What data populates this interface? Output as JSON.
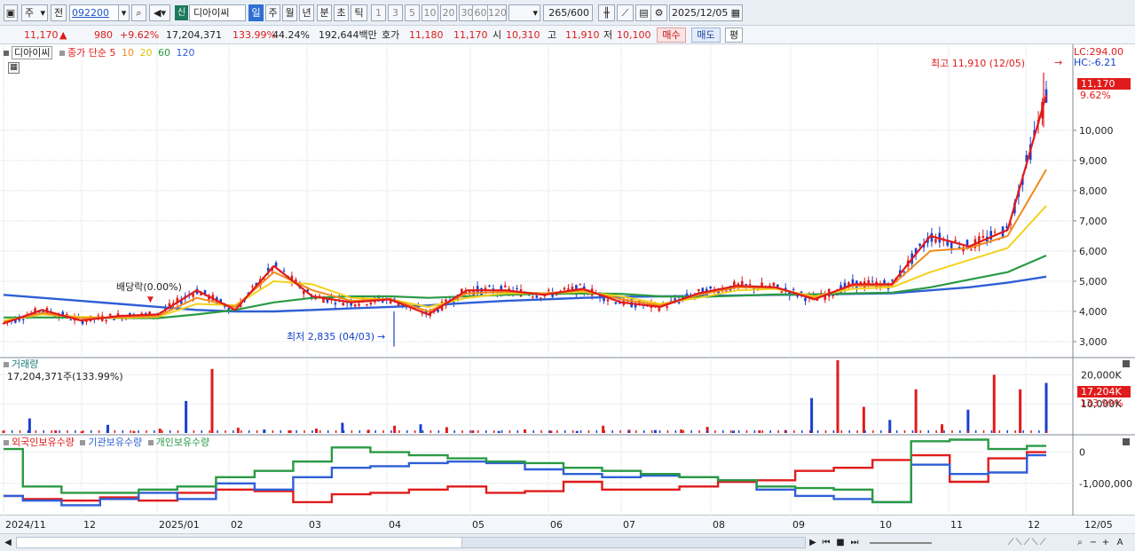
{
  "toolbar": {
    "period_select": "주",
    "prev_label": "전",
    "stock_code": "092200",
    "badge": "신",
    "stock_name": "디아이씨",
    "period_tabs": [
      "일",
      "주",
      "월",
      "년",
      "분",
      "초",
      "틱"
    ],
    "active_tab": "일",
    "minute_options": [
      "1",
      "3",
      "5",
      "10",
      "20",
      "30",
      "60",
      "120"
    ],
    "count": "265",
    "count_max": "/600",
    "date": "2025/12/05"
  },
  "quote": {
    "price": "11,170",
    "change_arrow": "▲",
    "change": "980",
    "change_pct": "+9.62%",
    "volume": "17,204,371",
    "volume_ratio": "133.99%",
    "turnover": "44.24%",
    "amount": "192,644백만",
    "ask_label": "호가",
    "ask1": "11,180",
    "ask2": "11,170",
    "open_label": "시",
    "open": "10,310",
    "high_label": "고",
    "high": "11,910",
    "low_label": "저",
    "low": "10,100",
    "buy_label": "매수",
    "sell_label": "매도",
    "eval_label": "평"
  },
  "price_panel": {
    "stock_label": "디아이씨",
    "ma_prefix": "종가 단순",
    "ma_periods": [
      "5",
      "10",
      "20",
      "60",
      "120"
    ],
    "ma_colors": [
      "#e01b1b",
      "#f08a1c",
      "#f2d21c",
      "#2a9a44",
      "#2f5fd6"
    ],
    "lc_label": "LC:294.00",
    "hc_label": "HC:-6.21",
    "last_price_label": "11,170",
    "last_pct_label": "9.62%",
    "high_annotation": "최고 11,910 (12/05)",
    "low_annotation": "최저 2,835 (04/03)",
    "dividend_annotation": "배당락(0.00%)"
  },
  "volume_panel": {
    "title": "거래량",
    "value_label": "17,204,371주(133.99%)",
    "last_label": "17,204K",
    "last_pct": "133.99%"
  },
  "holdings_panel": {
    "series_labels": [
      "외국인보유수량",
      "기관보유수량",
      "개인보유수량"
    ],
    "series_colors": [
      "#e01b1b",
      "#2f5fd6",
      "#2a9a44"
    ]
  },
  "chart_data": [
    {
      "type": "line",
      "title": "",
      "chart": "price",
      "x": [
        "2024/11",
        "12",
        "2025/01",
        "02",
        "03",
        "04",
        "05",
        "06",
        "07",
        "08",
        "09",
        "10",
        "11",
        "12",
        "12/05"
      ],
      "ylim": [
        2500,
        12200
      ],
      "yticks": [
        "3,000",
        "4,000",
        "5,000",
        "6,000",
        "7,000",
        "8,000",
        "9,000",
        "10,000"
      ],
      "series": [
        {
          "name": "5",
          "values": [
            3600,
            4050,
            3700,
            3850,
            3900,
            4700,
            4050,
            5500,
            4500,
            4300,
            4400,
            3900,
            4700,
            4700,
            4550,
            4750,
            4300,
            4150,
            4600,
            4850,
            4800,
            4400,
            4900,
            4900,
            6500,
            6150,
            6700,
            11170
          ]
        },
        {
          "name": "10",
          "values": [
            3650,
            3950,
            3780,
            3800,
            3850,
            4450,
            4150,
            5300,
            4700,
            4350,
            4420,
            4000,
            4600,
            4650,
            4600,
            4700,
            4400,
            4200,
            4550,
            4800,
            4780,
            4450,
            4850,
            4860,
            6000,
            6100,
            6500,
            8700
          ]
        },
        {
          "name": "20",
          "values": [
            3700,
            3900,
            3820,
            3780,
            3820,
            4250,
            4200,
            5000,
            4900,
            4450,
            4400,
            4150,
            4450,
            4600,
            4600,
            4650,
            4500,
            4250,
            4450,
            4700,
            4750,
            4500,
            4750,
            4800,
            5300,
            5700,
            6100,
            7500
          ]
        },
        {
          "name": "60",
          "values": [
            3800,
            3800,
            3800,
            3780,
            3780,
            3900,
            4050,
            4300,
            4450,
            4500,
            4500,
            4450,
            4500,
            4550,
            4580,
            4600,
            4580,
            4500,
            4480,
            4520,
            4560,
            4560,
            4600,
            4620,
            4800,
            5050,
            5300,
            5850
          ]
        },
        {
          "name": "120",
          "values": [
            4550,
            4450,
            4350,
            4250,
            4150,
            4050,
            4000,
            4000,
            4050,
            4100,
            4150,
            4200,
            4280,
            4350,
            4400,
            4450,
            4480,
            4500,
            4510,
            4530,
            4550,
            4560,
            4580,
            4600,
            4700,
            4800,
            4950,
            5150
          ]
        }
      ]
    },
    {
      "type": "bar",
      "title": "",
      "chart": "volume",
      "ylim": [
        0,
        25000
      ],
      "yticks": [
        "20,000K",
        "10,000K"
      ],
      "series": [
        {
          "name": "",
          "values": [
            800,
            5000,
            900,
            600,
            2800,
            700,
            1500,
            11000,
            22000,
            1800,
            1200,
            900,
            1500,
            3500,
            1100,
            2500,
            3000,
            2000,
            900,
            700,
            1200,
            800,
            700,
            2500,
            1100,
            1000,
            1200,
            2100,
            800,
            900,
            1000,
            12000,
            25000,
            9000,
            4500,
            15000,
            3000,
            8000,
            20000,
            15000,
            17204
          ]
        }
      ]
    },
    {
      "type": "line",
      "title": "",
      "chart": "holdings",
      "ylim": [
        -2000000,
        500000
      ],
      "yticks": [
        "0",
        "-1,000,000"
      ],
      "series": [
        {
          "name": "외국인보유수량",
          "values": [
            -1400000,
            -1500000,
            -1550000,
            -1450000,
            -1550000,
            -1300000,
            -1200000,
            -1250000,
            -1600000,
            -1350000,
            -1300000,
            -1200000,
            -1100000,
            -1300000,
            -1250000,
            -950000,
            -1200000,
            -1200000,
            -1100000,
            -950000,
            -900000,
            -600000,
            -500000,
            -250000,
            -100000,
            -950000,
            -200000,
            0
          ]
        },
        {
          "name": "기관보유수량",
          "values": [
            -1400000,
            -1550000,
            -1700000,
            -1500000,
            -1300000,
            -1500000,
            -1000000,
            -1200000,
            -800000,
            -500000,
            -450000,
            -350000,
            -300000,
            -350000,
            -550000,
            -700000,
            -800000,
            -750000,
            -800000,
            -900000,
            -1200000,
            -1400000,
            -1500000,
            -1600000,
            -400000,
            -700000,
            -650000,
            -100000
          ]
        },
        {
          "name": "개인보유수량",
          "values": [
            100000,
            -1100000,
            -1300000,
            -1300000,
            -1200000,
            -1100000,
            -800000,
            -600000,
            -300000,
            150000,
            0,
            -100000,
            -200000,
            -300000,
            -350000,
            -500000,
            -600000,
            -700000,
            -800000,
            -900000,
            -1100000,
            -1150000,
            -1200000,
            -1600000,
            350000,
            400000,
            100000,
            200000
          ]
        }
      ]
    }
  ],
  "scroll_icons": [
    "left-arrow-icon",
    "right-arrow-icon",
    "first-icon",
    "stop-icon",
    "last-icon",
    "zoom-out-icon",
    "zoom-in-icon",
    "font-icon"
  ]
}
